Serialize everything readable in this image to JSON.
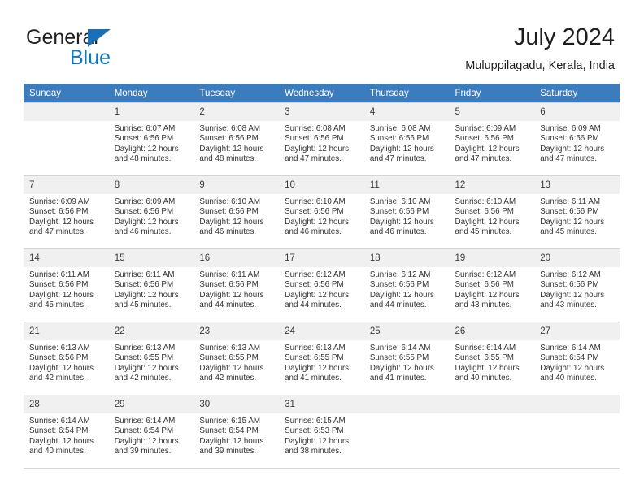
{
  "brand": {
    "name_part1": "General",
    "name_part2": "Blue",
    "accent_color": "#1278be",
    "triangle_color": "#1b6fb5"
  },
  "header": {
    "month_title": "July 2024",
    "location": "Muluppilagadu, Kerala, India"
  },
  "calendar": {
    "header_bg": "#3a7cbe",
    "daynum_bg": "#f0f0f0",
    "weekday_headers": [
      "Sunday",
      "Monday",
      "Tuesday",
      "Wednesday",
      "Thursday",
      "Friday",
      "Saturday"
    ],
    "weeks": [
      [
        {
          "day": "",
          "lines": []
        },
        {
          "day": "1",
          "lines": [
            "Sunrise: 6:07 AM",
            "Sunset: 6:56 PM",
            "Daylight: 12 hours",
            "and 48 minutes."
          ]
        },
        {
          "day": "2",
          "lines": [
            "Sunrise: 6:08 AM",
            "Sunset: 6:56 PM",
            "Daylight: 12 hours",
            "and 48 minutes."
          ]
        },
        {
          "day": "3",
          "lines": [
            "Sunrise: 6:08 AM",
            "Sunset: 6:56 PM",
            "Daylight: 12 hours",
            "and 47 minutes."
          ]
        },
        {
          "day": "4",
          "lines": [
            "Sunrise: 6:08 AM",
            "Sunset: 6:56 PM",
            "Daylight: 12 hours",
            "and 47 minutes."
          ]
        },
        {
          "day": "5",
          "lines": [
            "Sunrise: 6:09 AM",
            "Sunset: 6:56 PM",
            "Daylight: 12 hours",
            "and 47 minutes."
          ]
        },
        {
          "day": "6",
          "lines": [
            "Sunrise: 6:09 AM",
            "Sunset: 6:56 PM",
            "Daylight: 12 hours",
            "and 47 minutes."
          ]
        }
      ],
      [
        {
          "day": "7",
          "lines": [
            "Sunrise: 6:09 AM",
            "Sunset: 6:56 PM",
            "Daylight: 12 hours",
            "and 47 minutes."
          ]
        },
        {
          "day": "8",
          "lines": [
            "Sunrise: 6:09 AM",
            "Sunset: 6:56 PM",
            "Daylight: 12 hours",
            "and 46 minutes."
          ]
        },
        {
          "day": "9",
          "lines": [
            "Sunrise: 6:10 AM",
            "Sunset: 6:56 PM",
            "Daylight: 12 hours",
            "and 46 minutes."
          ]
        },
        {
          "day": "10",
          "lines": [
            "Sunrise: 6:10 AM",
            "Sunset: 6:56 PM",
            "Daylight: 12 hours",
            "and 46 minutes."
          ]
        },
        {
          "day": "11",
          "lines": [
            "Sunrise: 6:10 AM",
            "Sunset: 6:56 PM",
            "Daylight: 12 hours",
            "and 46 minutes."
          ]
        },
        {
          "day": "12",
          "lines": [
            "Sunrise: 6:10 AM",
            "Sunset: 6:56 PM",
            "Daylight: 12 hours",
            "and 45 minutes."
          ]
        },
        {
          "day": "13",
          "lines": [
            "Sunrise: 6:11 AM",
            "Sunset: 6:56 PM",
            "Daylight: 12 hours",
            "and 45 minutes."
          ]
        }
      ],
      [
        {
          "day": "14",
          "lines": [
            "Sunrise: 6:11 AM",
            "Sunset: 6:56 PM",
            "Daylight: 12 hours",
            "and 45 minutes."
          ]
        },
        {
          "day": "15",
          "lines": [
            "Sunrise: 6:11 AM",
            "Sunset: 6:56 PM",
            "Daylight: 12 hours",
            "and 45 minutes."
          ]
        },
        {
          "day": "16",
          "lines": [
            "Sunrise: 6:11 AM",
            "Sunset: 6:56 PM",
            "Daylight: 12 hours",
            "and 44 minutes."
          ]
        },
        {
          "day": "17",
          "lines": [
            "Sunrise: 6:12 AM",
            "Sunset: 6:56 PM",
            "Daylight: 12 hours",
            "and 44 minutes."
          ]
        },
        {
          "day": "18",
          "lines": [
            "Sunrise: 6:12 AM",
            "Sunset: 6:56 PM",
            "Daylight: 12 hours",
            "and 44 minutes."
          ]
        },
        {
          "day": "19",
          "lines": [
            "Sunrise: 6:12 AM",
            "Sunset: 6:56 PM",
            "Daylight: 12 hours",
            "and 43 minutes."
          ]
        },
        {
          "day": "20",
          "lines": [
            "Sunrise: 6:12 AM",
            "Sunset: 6:56 PM",
            "Daylight: 12 hours",
            "and 43 minutes."
          ]
        }
      ],
      [
        {
          "day": "21",
          "lines": [
            "Sunrise: 6:13 AM",
            "Sunset: 6:56 PM",
            "Daylight: 12 hours",
            "and 42 minutes."
          ]
        },
        {
          "day": "22",
          "lines": [
            "Sunrise: 6:13 AM",
            "Sunset: 6:55 PM",
            "Daylight: 12 hours",
            "and 42 minutes."
          ]
        },
        {
          "day": "23",
          "lines": [
            "Sunrise: 6:13 AM",
            "Sunset: 6:55 PM",
            "Daylight: 12 hours",
            "and 42 minutes."
          ]
        },
        {
          "day": "24",
          "lines": [
            "Sunrise: 6:13 AM",
            "Sunset: 6:55 PM",
            "Daylight: 12 hours",
            "and 41 minutes."
          ]
        },
        {
          "day": "25",
          "lines": [
            "Sunrise: 6:14 AM",
            "Sunset: 6:55 PM",
            "Daylight: 12 hours",
            "and 41 minutes."
          ]
        },
        {
          "day": "26",
          "lines": [
            "Sunrise: 6:14 AM",
            "Sunset: 6:55 PM",
            "Daylight: 12 hours",
            "and 40 minutes."
          ]
        },
        {
          "day": "27",
          "lines": [
            "Sunrise: 6:14 AM",
            "Sunset: 6:54 PM",
            "Daylight: 12 hours",
            "and 40 minutes."
          ]
        }
      ],
      [
        {
          "day": "28",
          "lines": [
            "Sunrise: 6:14 AM",
            "Sunset: 6:54 PM",
            "Daylight: 12 hours",
            "and 40 minutes."
          ]
        },
        {
          "day": "29",
          "lines": [
            "Sunrise: 6:14 AM",
            "Sunset: 6:54 PM",
            "Daylight: 12 hours",
            "and 39 minutes."
          ]
        },
        {
          "day": "30",
          "lines": [
            "Sunrise: 6:15 AM",
            "Sunset: 6:54 PM",
            "Daylight: 12 hours",
            "and 39 minutes."
          ]
        },
        {
          "day": "31",
          "lines": [
            "Sunrise: 6:15 AM",
            "Sunset: 6:53 PM",
            "Daylight: 12 hours",
            "and 38 minutes."
          ]
        },
        {
          "day": "",
          "lines": []
        },
        {
          "day": "",
          "lines": []
        },
        {
          "day": "",
          "lines": []
        }
      ]
    ]
  }
}
